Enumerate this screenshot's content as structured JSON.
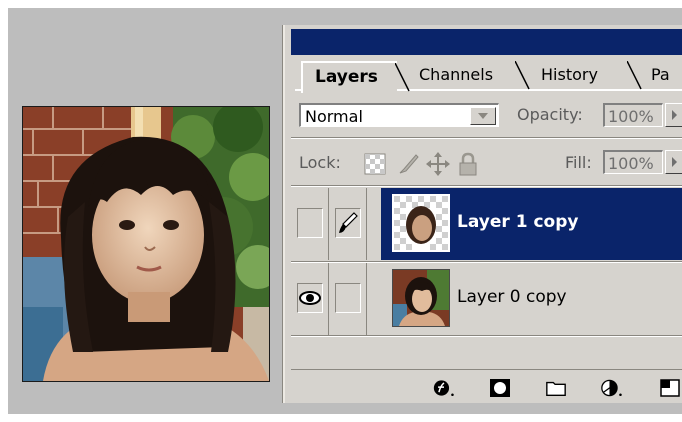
{
  "tabs": [
    {
      "label": "Layers",
      "active": true
    },
    {
      "label": "Channels",
      "active": false
    },
    {
      "label": "History",
      "active": false
    },
    {
      "label": "Pa",
      "active": false
    }
  ],
  "blend": {
    "mode": "Normal",
    "opacity_label": "Opacity:",
    "opacity_value": "100%"
  },
  "lock": {
    "label": "Lock:",
    "fill_label": "Fill:",
    "fill_value": "100%"
  },
  "layers": [
    {
      "name": "Layer 1 copy",
      "selected": true,
      "visible": false,
      "brush": true
    },
    {
      "name": "Layer 0 copy",
      "selected": false,
      "visible": true,
      "brush": false
    }
  ],
  "icons": {
    "bottom": [
      "layer-style-icon",
      "layer-mask-icon",
      "new-set-icon",
      "adjustment-layer-icon",
      "new-layer-icon"
    ],
    "lock": [
      "lock-transparency-icon",
      "lock-image-icon",
      "lock-position-icon",
      "lock-all-icon"
    ]
  },
  "colors": {
    "selection": "#0a246a",
    "panel": "#d6d3ce",
    "canvas": "#bdbdbd"
  }
}
